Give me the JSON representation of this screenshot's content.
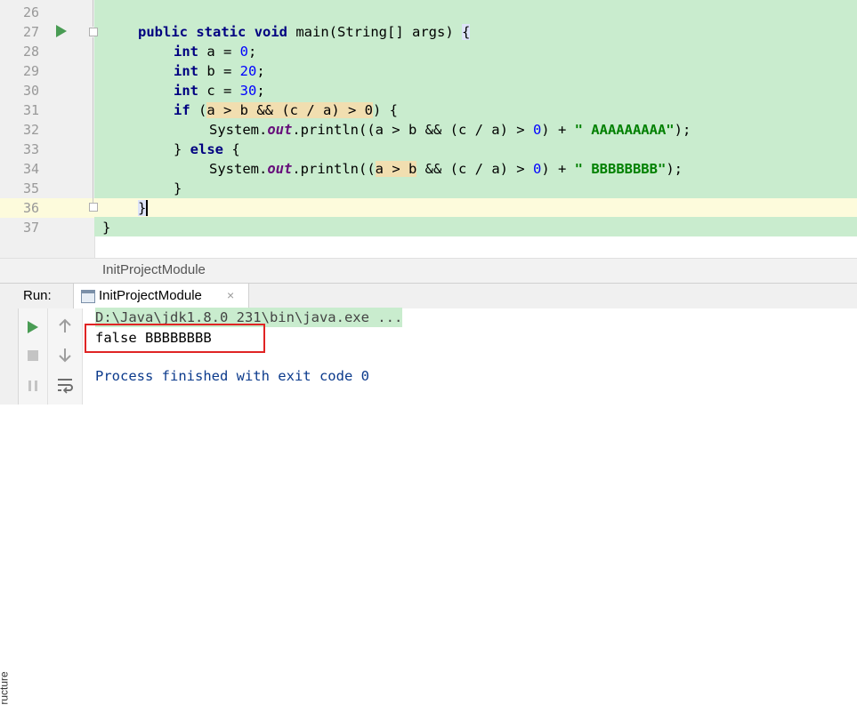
{
  "editor": {
    "line_numbers": [
      "26",
      "27",
      "28",
      "29",
      "30",
      "31",
      "32",
      "33",
      "34",
      "35",
      "36",
      "37"
    ],
    "lines": {
      "l27": {
        "kw1": "public",
        "kw2": "static",
        "kw3": "void",
        "rest": " main(String[] args) ",
        "brace": "{"
      },
      "l28": {
        "kw": "int",
        "rest": " a = ",
        "num": "0",
        ";": ";"
      },
      "l29": {
        "kw": "int",
        "rest": " b = ",
        "num": "20",
        "end": ";"
      },
      "l30": {
        "kw": "int",
        "rest": " c = ",
        "num": "30",
        "end": ";"
      },
      "l31": {
        "kw": "if",
        "sp": " (",
        "cond": "a > b && (c / a) > 0",
        "end": ") {"
      },
      "l32": {
        "pre": "System.",
        "out": "out",
        "mid": ".println((a > b && (c / a) > ",
        "num": "0",
        "mid2": ") + ",
        "str": "\" AAAAAAAAA\"",
        "end": ");"
      },
      "l33": {
        "pre": "} ",
        "kw": "else",
        "end": " {"
      },
      "l34": {
        "pre": "System.",
        "out": "out",
        "mid": ".println((",
        "hl": "a > b",
        "mid2": " && (c / a) > ",
        "num": "0",
        "mid3": ") + ",
        "str": "\" BBBBBBBB\"",
        "end": ");"
      },
      "l35": {
        "text": "}"
      },
      "l36": {
        "text": "}"
      },
      "l37": {
        "text": "}"
      }
    }
  },
  "breadcrumb": {
    "text": "InitProjectModule"
  },
  "run_panel": {
    "label": "Run:",
    "tab": "InitProjectModule",
    "close": "×",
    "icons": {
      "run": "run-icon",
      "stop": "stop-icon",
      "pause": "pause-icon",
      "up": "scroll-up-icon",
      "down": "scroll-down-icon",
      "wrap": "soft-wrap-icon"
    }
  },
  "side_tool": {
    "structure": "ructure"
  },
  "console": {
    "cmd": "D:\\Java\\jdk1.8.0_231\\bin\\java.exe ...",
    "out": "false BBBBBBBB",
    "exit": "Process finished with exit code 0"
  },
  "colors": {
    "code_bg": "#c9ecce",
    "current_line": "#fdfbdc",
    "keyword": "#000080",
    "string": "#008000",
    "number": "#0000ff",
    "highlight_box": "#e02424"
  }
}
